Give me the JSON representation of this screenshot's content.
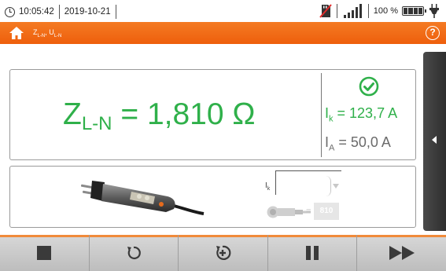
{
  "status_bar": {
    "time": "10:05:42",
    "date": "2019-10-21",
    "battery_percent": "100 %",
    "icons": [
      "clock-icon",
      "no-sd-card-icon",
      "signal-strength-icon",
      "battery-full-icon",
      "mains-plug-icon"
    ]
  },
  "title_bar": {
    "title_main_z": "Z",
    "title_sub_z": "L-N",
    "title_sep": ", ",
    "title_main_u": "U",
    "title_sub_u": "L-N",
    "home_icon": "home-icon",
    "help_label": "?"
  },
  "result": {
    "symbol": "Z",
    "symbol_sub": "L-N",
    "equals": " = ",
    "value": "1,810 Ω",
    "status_icon": "check-circle-icon",
    "status_color": "#2fb04a",
    "ik_symbol": "I",
    "ik_sub": "k",
    "ik_value": " = 123,7 A",
    "ia_symbol": "I",
    "ia_sub": "A",
    "ia_value": " = 50,0 A"
  },
  "probe_panel": {
    "probe_icon": "plug-probe-icon",
    "ik_label_main": "I",
    "ik_label_sub": "k",
    "ik_select_value": "",
    "adapter_icon": "adapter-icon",
    "adapter_equals": "=",
    "adapter_value": "810"
  },
  "toolbar": {
    "buttons": [
      "stop-icon",
      "reset-icon",
      "auto-measure-icon",
      "pause-icon",
      "fast-forward-icon"
    ]
  },
  "colors": {
    "accent_orange": "#f47a23",
    "result_green": "#2fb04a",
    "secondary_grey": "#6b6b6b"
  }
}
